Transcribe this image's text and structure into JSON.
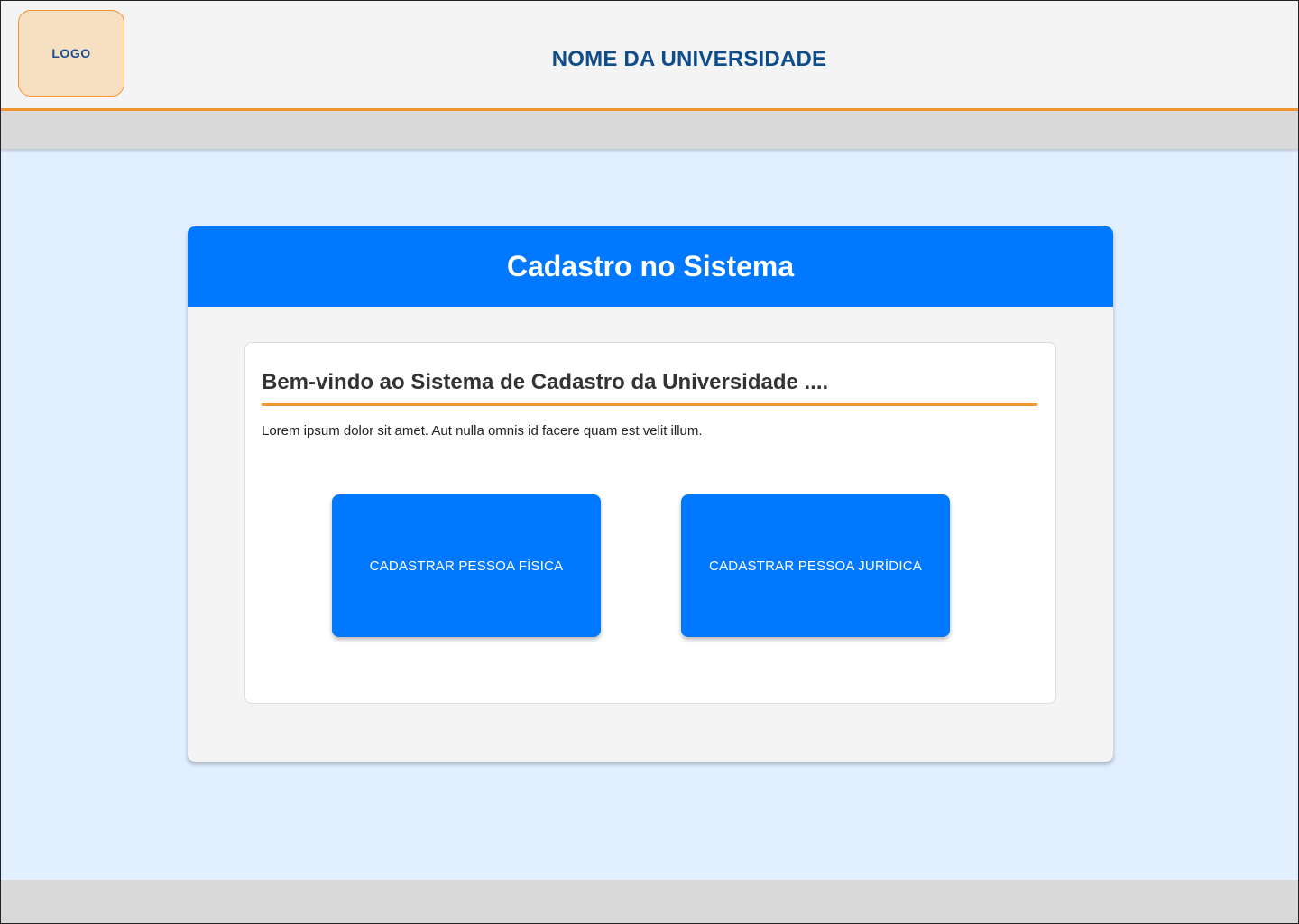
{
  "header": {
    "logo_label": "LOGO",
    "university_name": "NOME DA UNIVERSIDADE"
  },
  "card": {
    "title": "Cadastro no Sistema",
    "welcome_heading": "Bem-vindo ao Sistema de Cadastro da Universidade ....",
    "description": "Lorem ipsum dolor sit amet. Aut nulla omnis id facere quam est velit illum.",
    "buttons": {
      "pessoa_fisica": "CADASTRAR PESSOA FÍSICA",
      "pessoa_juridica": "CADASTRAR PESSOA JURÍDICA"
    }
  },
  "colors": {
    "primary": "#0078ff",
    "accent": "#f0962e",
    "university_text": "#0e4d8c",
    "page_background": "#e2effe"
  }
}
